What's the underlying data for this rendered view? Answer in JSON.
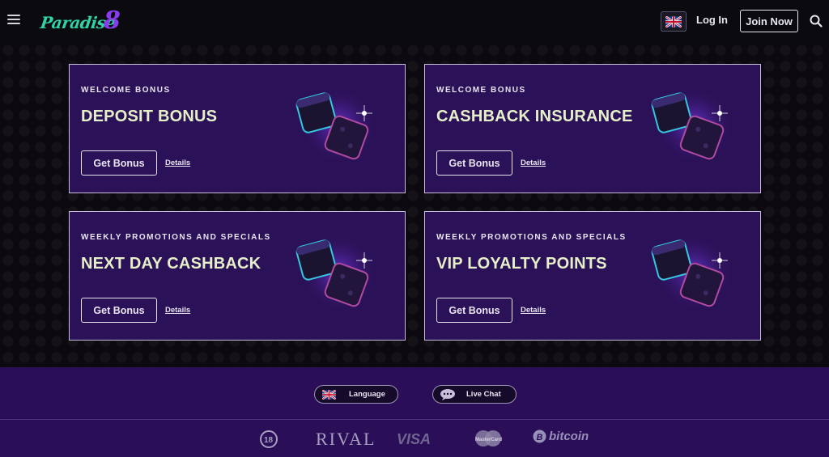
{
  "header": {
    "logo_text": "Paradise",
    "logo_number": "8",
    "login_label": "Log In",
    "join_label": "Join Now",
    "icons": [
      "menu-icon",
      "uk-flag-icon",
      "search-icon"
    ]
  },
  "promos": [
    {
      "subtitle": "WELCOME BONUS",
      "title": "DEPOSIT BONUS",
      "button": "Get Bonus",
      "details": "Details"
    },
    {
      "subtitle": "WELCOME BONUS",
      "title": "CASHBACK INSURANCE",
      "button": "Get Bonus",
      "details": "Details"
    },
    {
      "subtitle": "WEEKLY PROMOTIONS AND SPECIALS",
      "title": "NEXT DAY CASHBACK",
      "button": "Get Bonus",
      "details": "Details"
    },
    {
      "subtitle": "WEEKLY PROMOTIONS AND SPECIALS",
      "title": "VIP LOYALTY POINTS",
      "button": "Get Bonus",
      "details": "Details"
    }
  ],
  "footer": {
    "language_label": "Language",
    "livechat_label": "Live Chat",
    "payments": {
      "age": "18",
      "rival": "RIVAL",
      "visa": "VISA",
      "mastercard": "MasterCard",
      "bitcoin": "bitcoin"
    }
  },
  "colors": {
    "card_bg": "#2b1158",
    "footer_bg": "#2a0f58",
    "title_text": "#e6f0c8",
    "logo_green": "#2fd3a8",
    "logo_purple": "#8a3bf0"
  }
}
